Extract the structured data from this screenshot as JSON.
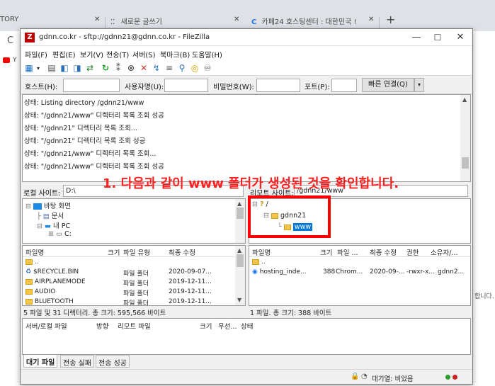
{
  "browser": {
    "tabs": [
      {
        "label": "TORY"
      },
      {
        "label": "새로운 글쓰기"
      },
      {
        "label": "카페24 호스팅센터 : 대한민국 !"
      }
    ],
    "close_glyph": "✕",
    "new_tab_glyph": "+",
    "side_text": "합니다."
  },
  "filezilla": {
    "title": "gdnn.co.kr - sftp://gdnn21@gdnn.co.kr - FileZilla",
    "menu": [
      "파일(F)",
      "편집(E)",
      "보기(V)",
      "전송(T)",
      "서버(S)",
      "북마크(B)",
      "도움말(H)"
    ],
    "quickconnect": {
      "host_label": "호스트(H):",
      "user_label": "사용자명(U):",
      "pass_label": "비밀번호(W):",
      "port_label": "포트(P):",
      "connect_button": "빠른 연결(Q)"
    },
    "log": [
      "상태:  Listing directory /gdnn21/www",
      "상태:  \"/gdnn21/www\" 디렉터리 목록 조회 성공",
      "상태:  \"/gdnn21\" 디렉터리 목록 조회...",
      "상태:  \"/gdnn21\" 디렉터리 목록 조회 성공",
      "상태:  \"/gdnn21/www\" 디렉터리 목록 조회...",
      "상태:  \"/gdnn21/www\" 디렉터리 목록 조회 성공"
    ],
    "local": {
      "site_label": "로컬 사이트:",
      "site_value": "D:\\",
      "tree": [
        "바탕 화면",
        "문서",
        "내 PC",
        "C:"
      ],
      "columns": [
        "파일명",
        "크기",
        "파일 유형",
        "최종 수정"
      ],
      "files": [
        {
          "name": "..",
          "type": "",
          "date": ""
        },
        {
          "name": "$RECYCLE.BIN",
          "type": "파일 폴더",
          "date": "2020-09-07..."
        },
        {
          "name": "AIRPLANEMODE",
          "type": "파일 폴더",
          "date": "2019-12-11..."
        },
        {
          "name": "AUDIO",
          "type": "파일 폴더",
          "date": "2019-12-11..."
        },
        {
          "name": "BLUETOOTH",
          "type": "파일 폴더",
          "date": "2019-12-11..."
        }
      ],
      "status": "5 파일 및 31 디렉터리. 총 크기: 595,566 바이트"
    },
    "remote": {
      "site_label": "리모트 사이트:",
      "site_value": "/gdnn21/www",
      "tree": [
        "/",
        "gdnn21",
        "www"
      ],
      "columns": [
        "파일명",
        "크기",
        "파일 ...",
        "최종 수정",
        "권한",
        "소유자/..."
      ],
      "files": [
        {
          "name": "..",
          "size": "",
          "type": "",
          "date": "",
          "perm": "",
          "owner": ""
        },
        {
          "name": "hosting_inde...",
          "size": "388",
          "type": "Chrom...",
          "date": "2020-09-...",
          "perm": "-rwxr-x...",
          "owner": "gdnn2..."
        }
      ],
      "status": "1 파일. 총 크기: 388 바이트"
    },
    "queue": {
      "columns": [
        "서버/로컬 파일",
        "방향",
        "리모트 파일",
        "크기",
        "우선...",
        "상태"
      ],
      "tabs": [
        "대기 파일",
        "전송 실패",
        "전송 성공"
      ]
    },
    "statusbar": {
      "queue": "대기열: 비었음"
    }
  },
  "annotation": {
    "text": "1. 다음과 같이 www 폴더가 생성된 것을 확인합니다.",
    "color": "#ff1f1f"
  }
}
